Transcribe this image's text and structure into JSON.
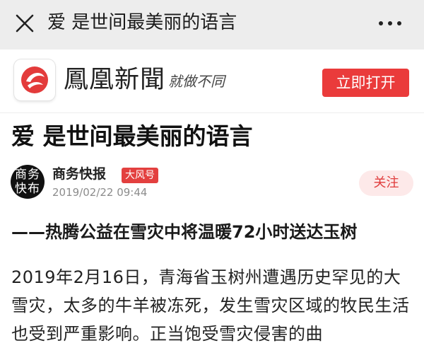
{
  "topbar": {
    "close_icon": "close-icon",
    "title": "爱 是世间最美丽的语言",
    "more_icon": "more-dots-icon"
  },
  "brand": {
    "logo_icon": "phoenix-logo-icon",
    "name": "鳳凰新聞",
    "slogan": "就做不同",
    "open_button": "立即打开",
    "accent_color": "#ea3b3b"
  },
  "article": {
    "title": "爱 是世间最美丽的语言",
    "author": {
      "avatar_text_line1": "商务",
      "avatar_text_line2": "快布",
      "name": "商务快报",
      "badge": "大风号",
      "date": "2019/02/22 09:44",
      "follow_label": "关注"
    },
    "subtitle": "——热腾公益在雪灾中将温暖72小时送达玉树",
    "body": "2019年2月16日，青海省玉树州遭遇历史罕见的大雪灾，太多的牛羊被冻死，发生雪灾区域的牧民生活也受到严重影响。正当饱受雪灾侵害的曲"
  }
}
